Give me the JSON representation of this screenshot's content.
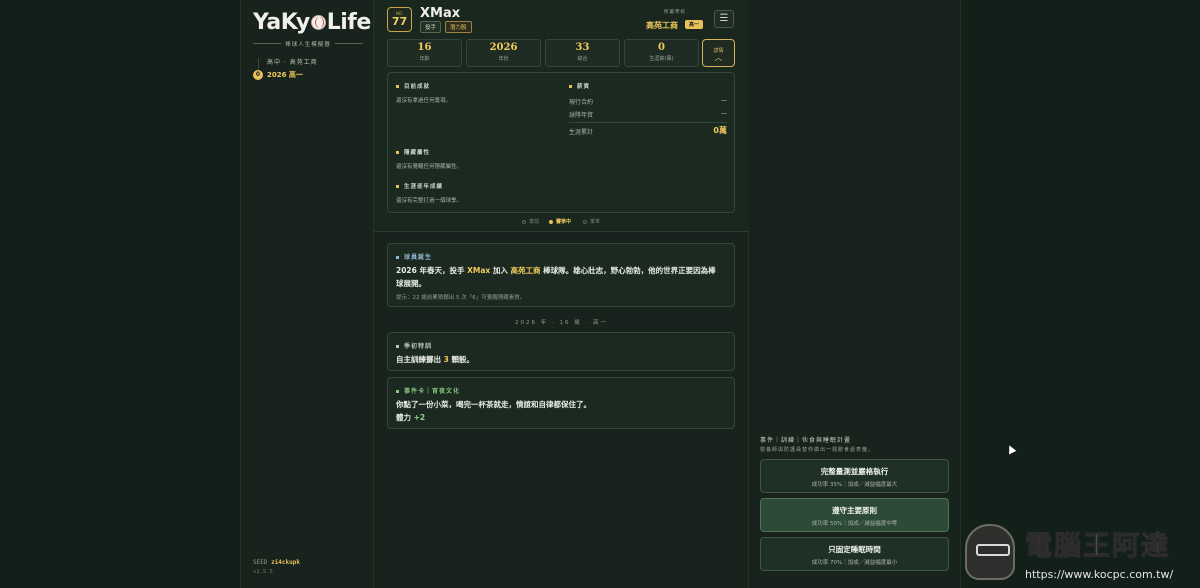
{
  "sidebar": {
    "logo_left": "YaKy",
    "logo_right": "Life",
    "subtitle": "棒球人生模擬器",
    "stage_label": "高中 · 高苑工商",
    "stage_number": "0",
    "stage_current": "2026 高一",
    "seed_label": "SEED",
    "seed_value": "zi4ckupk",
    "version": "v1.5.5"
  },
  "player": {
    "number_caption": "NO.",
    "number": "77",
    "name": "XMax",
    "tag_position": "投手",
    "tag_potential": "潛力股",
    "school_caption": "所屬學校",
    "school": "高苑工商",
    "grade": "高一",
    "menu_icon": "☰"
  },
  "stats": [
    {
      "value": "16",
      "label": "年齡"
    },
    {
      "value": "2026",
      "label": "年份"
    },
    {
      "value": "33",
      "label": "綜合"
    },
    {
      "value": "0",
      "label": "生涯薪(萬)"
    }
  ],
  "detail_button": {
    "label": "詳情",
    "chevron": "︿"
  },
  "panel": {
    "achievements_title": "目前成就",
    "achievements_text": "還沒有拿過任何獎項。",
    "salary_title": "薪資",
    "contract_label": "現行合約",
    "contract_value": "—",
    "annual_label": "球隊年資",
    "annual_value": "—",
    "career_label": "生涯累計",
    "career_value": "0萬",
    "hidden_title": "隱藏屬性",
    "hidden_text": "還沒有覺醒任何隱藏屬性。",
    "record_title": "生涯逐年成績",
    "record_text": "還沒有完整打過一個球季。"
  },
  "phases": [
    "季前",
    "賽季中",
    "季末"
  ],
  "story": {
    "birth_title": "球員誕生",
    "birth_text_1": "2026 年春天，投手 ",
    "birth_name": "XMax",
    "birth_text_2": " 加入 ",
    "birth_school": "高苑工商",
    "birth_text_3": " 棒球隊。雄心壯志，野心勃勃，他的世界正要因為棒",
    "birth_text_4": "球展開。",
    "birth_hint": "提示：22 歲前累積擲出 5 次「6」可覺醒隱藏素質。",
    "date_separator": "2026 年 · 16 歲 · 高一",
    "training_title": "季初特訓",
    "training_text_1": "自主訓練擲出 ",
    "training_dice": "3",
    "training_text_2": " 顆骰。",
    "event_title": "事件卡｜宵夜文化",
    "event_text": "你點了一份小菜，喝完一杯茶就走，情誼和自律都保住了。",
    "event_effect_label": "體力 ",
    "event_effect_value": "+2"
  },
  "choices": {
    "heading": "事件｜訓練｜伙食與睡眠計畫",
    "subheading": "營養師與防護員替你做出一週飲食處表籤。",
    "options": [
      {
        "title": "完整量測並嚴格執行",
        "subtitle": "成功率 35%｜加成／減益幅度最大"
      },
      {
        "title": "遵守主要原則",
        "subtitle": "成功率 50%｜加成／減益幅度中等"
      },
      {
        "title": "只固定睡眠時間",
        "subtitle": "成功率 70%｜加成／減益幅度最小"
      }
    ]
  },
  "watermark": {
    "title": "電腦王阿達",
    "url": "https://www.kocpc.com.tw/"
  },
  "colors": {
    "accent": "#e8c15a",
    "background": "#131f19",
    "panel": "#1c2921",
    "selected_choice": "#2c4a35"
  }
}
